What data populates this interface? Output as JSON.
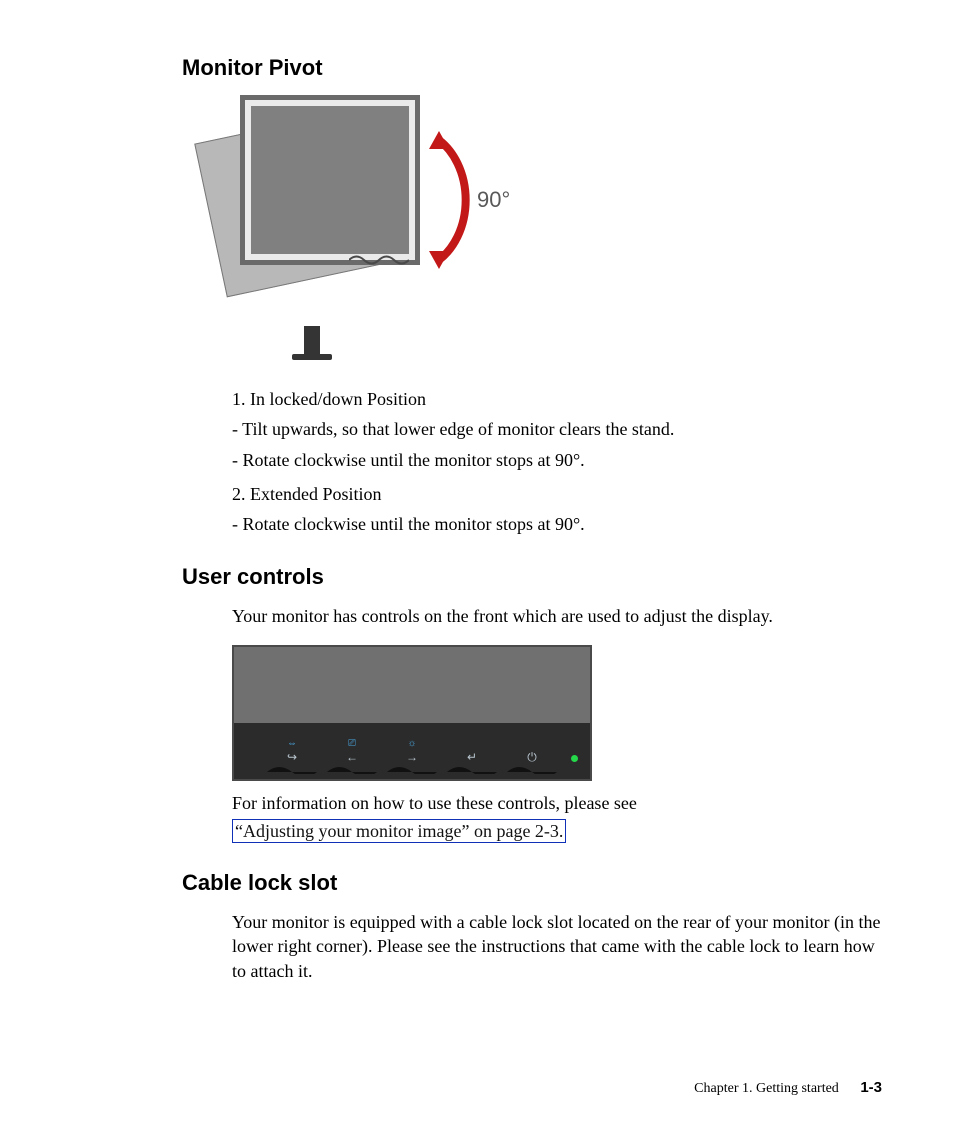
{
  "sections": {
    "pivot": {
      "heading": "Monitor Pivot",
      "angle_label": "90°",
      "steps": [
        "1. In locked/down Position",
        "- Tilt upwards, so that lower edge of monitor clears the stand.",
        "- Rotate clockwise until the monitor stops at 90°.",
        "2. Extended Position",
        "- Rotate clockwise until the monitor stops at 90°."
      ]
    },
    "user_controls": {
      "heading": "User controls",
      "intro": "Your monitor has controls on the front which are used to adjust the display.",
      "followup": "For information on how to use these controls, please see",
      "link_text": "“Adjusting your monitor image” on page 2-3.",
      "buttons": [
        {
          "top_icon_name": "input-icon",
          "top": "⇔",
          "bottom_icon_name": "exit-icon",
          "bottom": "↪"
        },
        {
          "top_icon_name": "auto-adjust-icon",
          "top": "⎚",
          "bottom_icon_name": "left-arrow-icon",
          "bottom": "←"
        },
        {
          "top_icon_name": "brightness-icon",
          "top": "☼",
          "bottom_icon_name": "right-arrow-icon",
          "bottom": "→"
        },
        {
          "top_icon_name": "blank-icon",
          "top": "",
          "bottom_icon_name": "enter-icon",
          "bottom": "↵"
        },
        {
          "top_icon_name": "blank-icon",
          "top": "",
          "bottom_icon_name": "power-icon",
          "bottom": "⏻"
        }
      ]
    },
    "cable_lock": {
      "heading": "Cable lock slot",
      "body": "Your monitor is equipped with a cable lock slot located on the rear of your monitor (in the lower right corner). Please see the instructions that came with the cable lock to learn how to attach it."
    }
  },
  "footer": {
    "chapter": "Chapter 1. Getting started",
    "page": "1-3"
  }
}
